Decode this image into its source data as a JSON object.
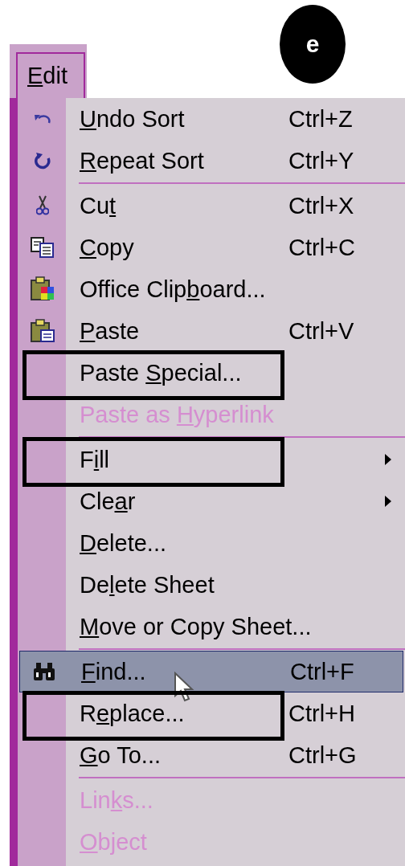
{
  "badge": {
    "text": "e"
  },
  "menubar": {
    "tab": {
      "key": "E",
      "after": "dit",
      "selected": true
    }
  },
  "menu": {
    "items": [
      {
        "kind": "item",
        "key": "U",
        "after": "ndo Sort",
        "shortcut": "Ctrl+Z",
        "disabled": false,
        "selected": false,
        "outlined": false,
        "submenu": false
      },
      {
        "kind": "item",
        "key": "R",
        "after": "epeat Sort",
        "shortcut": "Ctrl+Y",
        "disabled": false,
        "selected": false,
        "outlined": false,
        "submenu": false
      },
      {
        "kind": "separator"
      },
      {
        "kind": "item",
        "before": "Cu",
        "key": "t",
        "shortcut": "Ctrl+X",
        "disabled": false,
        "selected": false,
        "outlined": false,
        "submenu": false
      },
      {
        "kind": "item",
        "key": "C",
        "after": "opy",
        "shortcut": "Ctrl+C",
        "disabled": false,
        "selected": false,
        "outlined": false,
        "submenu": false
      },
      {
        "kind": "item",
        "before": "Office Clip",
        "key": "b",
        "after": "oard...",
        "disabled": false,
        "selected": false,
        "outlined": false,
        "submenu": false
      },
      {
        "kind": "item",
        "key": "P",
        "after": "aste",
        "shortcut": "Ctrl+V",
        "disabled": false,
        "selected": false,
        "outlined": false,
        "submenu": false
      },
      {
        "kind": "item",
        "before": "Paste ",
        "key": "S",
        "after": "pecial...",
        "disabled": false,
        "selected": false,
        "outlined": true,
        "submenu": false
      },
      {
        "kind": "item",
        "before": "Paste as ",
        "key": "H",
        "after": "yperlink",
        "disabled": true,
        "selected": false,
        "outlined": false,
        "submenu": false
      },
      {
        "kind": "separator"
      },
      {
        "kind": "item",
        "before": "F",
        "key": "i",
        "after": "ll",
        "disabled": false,
        "selected": false,
        "outlined": true,
        "submenu": true
      },
      {
        "kind": "item",
        "before": "Cle",
        "key": "a",
        "after": "r",
        "disabled": false,
        "selected": false,
        "outlined": false,
        "submenu": true
      },
      {
        "kind": "item",
        "key": "D",
        "after": "elete...",
        "disabled": false,
        "selected": false,
        "outlined": false,
        "submenu": false
      },
      {
        "kind": "item",
        "before": "De",
        "key": "l",
        "after": "ete Sheet",
        "disabled": false,
        "selected": false,
        "outlined": false,
        "submenu": false
      },
      {
        "kind": "item",
        "key": "M",
        "after": "ove or Copy Sheet...",
        "disabled": false,
        "selected": false,
        "outlined": false,
        "submenu": false
      },
      {
        "kind": "separator"
      },
      {
        "kind": "item",
        "key": "F",
        "after": "ind...",
        "shortcut": "Ctrl+F",
        "disabled": false,
        "selected": true,
        "outlined": false,
        "submenu": false
      },
      {
        "kind": "item",
        "before": "R",
        "key": "e",
        "after": "place...",
        "shortcut": "Ctrl+H",
        "disabled": false,
        "selected": false,
        "outlined": true,
        "submenu": false
      },
      {
        "kind": "item",
        "key": "G",
        "after": "o To...",
        "shortcut": "Ctrl+G",
        "disabled": false,
        "selected": false,
        "outlined": false,
        "submenu": false
      },
      {
        "kind": "separator"
      },
      {
        "kind": "item",
        "before": "Lin",
        "key": "k",
        "after": "s...",
        "disabled": true,
        "selected": false,
        "outlined": false,
        "submenu": false
      },
      {
        "kind": "item",
        "key": "O",
        "after": "bject",
        "disabled": true,
        "selected": false,
        "outlined": false,
        "submenu": false
      }
    ]
  }
}
